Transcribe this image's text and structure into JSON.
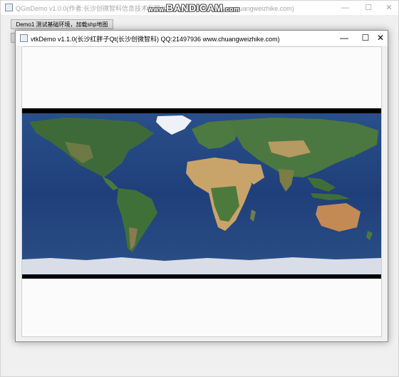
{
  "background_window": {
    "title": "QGisDemo v1.0.0(作者:长沙创微智科信息技术有限公司 QQ:21497936 www.chuangweizhike.com)",
    "min_symbol": "—",
    "max_symbol": "☐",
    "close_symbol": "✕",
    "demo_button_label": "Demo1 测试基础环境，加载shp地图"
  },
  "watermark": {
    "prefix": "www.",
    "brand": "BANDICAM",
    "suffix": ".com"
  },
  "vtk_window": {
    "title": "vtkDemo v1.1.0(长沙红胖子Qt(长沙创微智科) QQ:21497936 www.chuangweizhike.com)",
    "min_symbol": "—",
    "max_symbol": "☐",
    "close_symbol": "✕"
  },
  "map": {
    "ocean_color": "#1f3f7a",
    "land_color": "#3f6b3a",
    "desert_color": "#c9a46a",
    "ice_color": "#dfe3ec",
    "band_color": "#000000"
  }
}
